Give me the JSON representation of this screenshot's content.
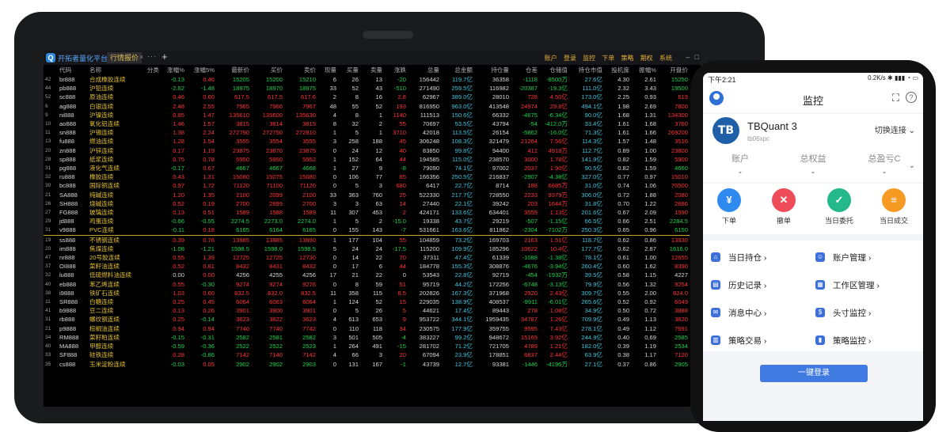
{
  "desktop": {
    "app_title": "开拓者量化平台",
    "active_tab": "行情报价",
    "menu": [
      "账户",
      "登录",
      "监控",
      "下单",
      "策略",
      "期权",
      "系统"
    ],
    "columns": [
      "",
      "代码",
      "名称",
      "分类",
      "涨幅%",
      "涨幅5%",
      "最新价",
      "买价",
      "卖价",
      "现量",
      "买量",
      "卖量",
      "涨跌",
      "总量",
      "总金额",
      "持仓量",
      "仓差",
      "仓储值",
      "持仓市值",
      "投机度",
      "振幅%",
      "开盘价"
    ],
    "rows": [
      [
        "42",
        "br888",
        "合成橡胶连续",
        "",
        "-0.13",
        "0.46",
        "15205",
        "15200",
        "15210",
        "6",
        "26",
        "13",
        "-20",
        "156442",
        "119.7亿",
        "36358",
        "-1118",
        "-8500万",
        "27.6亿",
        "4.30",
        "2.61",
        "15250"
      ],
      [
        "44",
        "pb888",
        "沪铅连续",
        "",
        "-2.62",
        "-1.48",
        "18975",
        "18970",
        "18975",
        "33",
        "52",
        "43",
        "-510",
        "271490",
        "259.5亿",
        "116982",
        "-20387",
        "-19.3亿",
        "111.0亿",
        "2.32",
        "3.43",
        "19500"
      ],
      [
        "52",
        "sc888",
        "原油连续",
        "",
        "0.46",
        "0.60",
        "617.5",
        "617.5",
        "617.6",
        "2",
        "8",
        "16",
        "2.8",
        "62967",
        "389.0亿",
        "28010",
        "728",
        "4.50亿",
        "173.0亿",
        "2.25",
        "0.93",
        "619"
      ],
      [
        "6",
        "ag888",
        "白银连续",
        "",
        "2.48",
        "2.55",
        "7965",
        "7966",
        "7967",
        "48",
        "55",
        "52",
        "193",
        "816950",
        "963.0亿",
        "413548",
        "24974",
        "29.8亿",
        "494.1亿",
        "1.98",
        "2.69",
        "7800"
      ],
      [
        "9",
        "ni888",
        "沪镍连续",
        "",
        "0.85",
        "1.47",
        "135610",
        "135600",
        "135630",
        "4",
        "8",
        "1",
        "1140",
        "111513",
        "150.6亿",
        "66332",
        "-4675",
        "-6.34亿",
        "90.0亿",
        "1.68",
        "1.31",
        "134300"
      ],
      [
        "10",
        "ao888",
        "氧化铝连续",
        "",
        "1.46",
        "1.57",
        "3815",
        "3814",
        "3815",
        "8",
        "32",
        "2",
        "55",
        "70697",
        "53.5亿",
        "43794",
        "-54",
        "-412.0万",
        "33.4亿",
        "1.61",
        "1.68",
        "3760"
      ],
      [
        "11",
        "sn888",
        "沪锡连续",
        "",
        "1.38",
        "2.24",
        "272790",
        "272750",
        "272810",
        "1",
        "5",
        "1",
        "3710",
        "42018",
        "113.5亿",
        "26154",
        "-5862",
        "-16.0亿",
        "71.3亿",
        "1.61",
        "1.66",
        "269200"
      ],
      [
        "13",
        "fu888",
        "燃油连续",
        "",
        "1.28",
        "1.54",
        "3555",
        "3554",
        "3555",
        "3",
        "258",
        "188",
        "45",
        "306248",
        "108.3亿",
        "321479",
        "21264",
        "7.56亿",
        "114.3亿",
        "1.57",
        "1.48",
        "3516"
      ],
      [
        "20",
        "zn888",
        "沪锌连续",
        "",
        "0.17",
        "1.19",
        "23875",
        "23870",
        "23875",
        "0",
        "24",
        "12",
        "40",
        "83850",
        "99.8亿",
        "94400",
        "412",
        "4918万",
        "112.7亿",
        "0.89",
        "1.00",
        "23800"
      ],
      [
        "28",
        "sp888",
        "纸浆连续",
        "",
        "0.75",
        "0.78",
        "5950",
        "5950",
        "5952",
        "1",
        "152",
        "64",
        "44",
        "194585",
        "115.0亿",
        "238570",
        "3000",
        "1.78亿",
        "141.9亿",
        "0.82",
        "1.59",
        "5900"
      ],
      [
        "31",
        "pg888",
        "液化气连续",
        "",
        "-0.17",
        "0.67",
        "4667",
        "4667",
        "4668",
        "1",
        "27",
        "9",
        "-8",
        "79090",
        "74.1亿",
        "97002",
        "2037",
        "1.90亿",
        "90.5亿",
        "0.82",
        "1.59",
        "4660"
      ],
      [
        "32",
        "ru888",
        "橡胶连续",
        "",
        "0.43",
        "1.31",
        "15080",
        "15075",
        "15080",
        "0",
        "106",
        "77",
        "65",
        "166356",
        "250.5亿",
        "216837",
        "-2907",
        "-4.38亿",
        "327.0亿",
        "0.77",
        "0.97",
        "15010"
      ],
      [
        "30",
        "bc888",
        "国际铜连续",
        "",
        "0.97",
        "1.72",
        "71120",
        "71100",
        "71120",
        "0",
        "5",
        "3",
        "680",
        "6417",
        "22.7亿",
        "8714",
        "188",
        "6685万",
        "31.0亿",
        "0.74",
        "1.06",
        "70500"
      ],
      [
        "21",
        "SA888",
        "纯碱连续",
        "",
        "1.20",
        "1.35",
        "2100",
        "2099",
        "2100",
        "33",
        "363",
        "760",
        "25",
        "522330",
        "217.7亿",
        "728550",
        "2233",
        "9379万",
        "306.0亿",
        "0.72",
        "1.88",
        "2080"
      ],
      [
        "26",
        "SH888",
        "烧碱连续",
        "",
        "0.52",
        "0.19",
        "2700",
        "2699",
        "2700",
        "3",
        "3",
        "63",
        "14",
        "27440",
        "22.1亿",
        "39242",
        "203",
        "1644万",
        "31.8亿",
        "0.70",
        "1.22",
        "2686"
      ],
      [
        "27",
        "FG888",
        "玻璃连续",
        "",
        "0.13",
        "0.51",
        "1589",
        "1588",
        "1589",
        "11",
        "307",
        "453",
        "2",
        "424171",
        "133.6亿",
        "634401",
        "3559",
        "1.13亿",
        "201.6亿",
        "0.67",
        "2.09",
        "1590"
      ],
      [
        "29",
        "jd888",
        "鸡蛋连续",
        "",
        "-0.66",
        "-0.55",
        "2274.5",
        "2273.0",
        "2274.0",
        "1",
        "5",
        "2",
        "-15.0",
        "19338",
        "43.7亿",
        "29219",
        "-507",
        "-1.15亿",
        "66.5亿",
        "0.66",
        "2.51",
        "2284.5"
      ],
      [
        "31",
        "v9888",
        "PVC连续",
        "",
        "-0.11",
        "0.18",
        "6165",
        "6164",
        "6165",
        "0",
        "155",
        "143",
        "-7",
        "531661",
        "163.6亿",
        "811862",
        "-2304",
        "-7102万",
        "250.3亿",
        "0.65",
        "0.96",
        "6150"
      ],
      [
        "19",
        "ss888",
        "不锈钢连续",
        "",
        "0.39",
        "0.76",
        "13985",
        "13985",
        "13990",
        "1",
        "177",
        "104",
        "55",
        "104859",
        "73.2亿",
        "169703",
        "2163",
        "1.51亿",
        "118.7亿",
        "0.62",
        "0.86",
        "13930"
      ],
      [
        "20",
        "im888",
        "焦煤连续",
        "",
        "-1.08",
        "-1.21",
        "1598.5",
        "1598.0",
        "1598.5",
        "5",
        "24",
        "24",
        "-17.5",
        "115200",
        "109.9亿",
        "185296",
        "10622",
        "10.4亿",
        "177.7亿",
        "0.62",
        "2.87",
        "1616.0"
      ],
      [
        "47",
        "nr888",
        "20号胶连续",
        "",
        "0.55",
        "1.39",
        "12725",
        "12725",
        "12730",
        "0",
        "14",
        "22",
        "70",
        "37311",
        "47.4亿",
        "61339",
        "-1088",
        "-1.38亿",
        "78.1亿",
        "0.61",
        "1.00",
        "12655"
      ],
      [
        "37",
        "OI888",
        "菜籽油连续",
        "",
        "0.52",
        "0.81",
        "8432",
        "8431",
        "8432",
        "0",
        "17",
        "6",
        "44",
        "184778",
        "155.3亿",
        "308876",
        "-4676",
        "-3.94亿",
        "260.4亿",
        "0.60",
        "1.62",
        "8390"
      ],
      [
        "32",
        "lu888",
        "低硫燃料油连续",
        "",
        "0.00",
        "0.00",
        "4256",
        "4255",
        "4256",
        "17",
        "21",
        "22",
        "0",
        "53543",
        "22.8亿",
        "92719",
        "-454",
        "-1932万",
        "39.5亿",
        "0.58",
        "1.15",
        "4227"
      ],
      [
        "40",
        "eb888",
        "苯乙烯连续",
        "",
        "0.55",
        "-0.30",
        "9274",
        "9274",
        "9276",
        "0",
        "8",
        "59",
        "51",
        "95719",
        "44.2亿",
        "172256",
        "-6748",
        "-3.13亿",
        "79.9亿",
        "0.56",
        "1.32",
        "9254"
      ],
      [
        "38",
        "i9888",
        "铁矿石连续",
        "",
        "1.03",
        "0.60",
        "832.5",
        "832.0",
        "832.5",
        "11",
        "358",
        "115",
        "8.5",
        "202826",
        "167.3亿",
        "371968",
        "2920",
        "2.43亿",
        "309.7亿",
        "0.55",
        "2.00",
        "824.0"
      ],
      [
        "11",
        "SR888",
        "白糖连续",
        "",
        "0.25",
        "0.45",
        "6064",
        "6063",
        "6064",
        "1",
        "124",
        "52",
        "15",
        "229035",
        "138.9亿",
        "408537",
        "-9911",
        "-6.01亿",
        "265.6亿",
        "0.52",
        "0.92",
        "6049"
      ],
      [
        "41",
        "b9888",
        "豆二连续",
        "",
        "0.13",
        "0.26",
        "3901",
        "3900",
        "3901",
        "0",
        "5",
        "26",
        "5",
        "44621",
        "17.4亿",
        "89443",
        "278",
        "1.08亿",
        "34.9亿",
        "0.50",
        "0.72",
        "3888"
      ],
      [
        "31",
        "rb888",
        "螺纹钢连续",
        "",
        "0.25",
        "-0.14",
        "3623",
        "3622",
        "3623",
        "4",
        "613",
        "653",
        "9",
        "953722",
        "344.1亿",
        "1959435",
        "34787",
        "1.26亿",
        "709.9亿",
        "0.49",
        "1.13",
        "3620"
      ],
      [
        "21",
        "p9888",
        "棕榈油连续",
        "",
        "0.94",
        "0.94",
        "7740",
        "7740",
        "7742",
        "0",
        "110",
        "118",
        "34",
        "230575",
        "177.9亿",
        "359755",
        "9595",
        "7.43亿",
        "278.1亿",
        "0.49",
        "1.12",
        "7691"
      ],
      [
        "34",
        "RM888",
        "菜籽粕连续",
        "",
        "-0.15",
        "-0.31",
        "2582",
        "2581",
        "2582",
        "3",
        "501",
        "505",
        "-4",
        "383227",
        "99.2亿",
        "948672",
        "15169",
        "3.92亿",
        "244.9亿",
        "0.40",
        "0.69",
        "2585"
      ],
      [
        "40",
        "MA888",
        "甲醇连续",
        "",
        "-0.59",
        "-0.36",
        "2522",
        "2522",
        "2523",
        "1",
        "264",
        "491",
        "-15",
        "281702",
        "71.2亿",
        "721705",
        "4789",
        "1.21亿",
        "182.0亿",
        "0.39",
        "1.19",
        "2534"
      ],
      [
        "33",
        "SF888",
        "硅铁连续",
        "",
        "0.28",
        "-0.86",
        "7142",
        "7140",
        "7142",
        "4",
        "66",
        "3",
        "20",
        "67094",
        "23.9亿",
        "178851",
        "6837",
        "2.44亿",
        "63.9亿",
        "0.38",
        "1.17",
        "7120"
      ],
      [
        "35",
        "cs888",
        "玉米淀粉连续",
        "",
        "-0.03",
        "0.05",
        "2902",
        "2902",
        "2903",
        "0",
        "131",
        "167",
        "-1",
        "43739",
        "12.7亿",
        "93381",
        "-1446",
        "-4196万",
        "27.1亿",
        "0.37",
        "0.86",
        "2905"
      ]
    ]
  },
  "phone": {
    "time": "下午2:21",
    "status_right": "0.2K/s ✱ ▮▮▮ ◔ ▭",
    "header_title": "监控",
    "account_name": "TBQuant 3",
    "account_id": "tb06xpc",
    "switch_label": "切换连接",
    "stats": [
      {
        "label": "账户",
        "value": "-"
      },
      {
        "label": "总权益",
        "value": "-"
      },
      {
        "label": "总盈亏C",
        "value": "-"
      }
    ],
    "quick_actions": [
      {
        "label": "下单",
        "color": "#2f8af0",
        "glyph": "¥"
      },
      {
        "label": "撤单",
        "color": "#ef4c5a",
        "glyph": "✕"
      },
      {
        "label": "当日委托",
        "color": "#24b88a",
        "glyph": "✓"
      },
      {
        "label": "当日成交",
        "color": "#f59a23",
        "glyph": "≡"
      }
    ],
    "menu": [
      {
        "label": "当日持仓 ›"
      },
      {
        "label": "账户管理 ›"
      },
      {
        "label": "历史记录 ›"
      },
      {
        "label": "工作区管理 ›"
      },
      {
        "label": "消息中心 ›"
      },
      {
        "label": "头寸监控 ›"
      },
      {
        "label": "策略交易 ›"
      },
      {
        "label": "策略监控 ›"
      }
    ],
    "login_label": "一键登录"
  }
}
